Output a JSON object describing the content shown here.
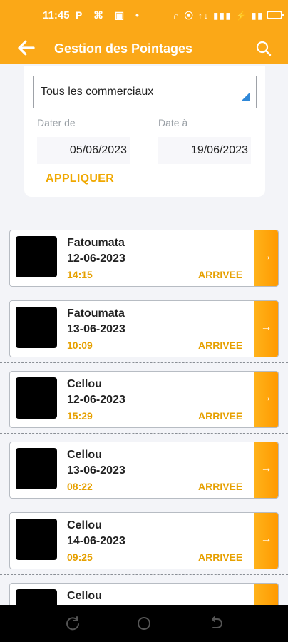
{
  "status_bar": {
    "time": "11:45",
    "left_icons": "P ⌘ ▣ •",
    "right_icons": "∩ ⦿ ↑↓ ▮▮▮ ⚡ ▮▮"
  },
  "app_bar": {
    "title": "Gestion des Pointages",
    "back_icon": "back-arrow-icon",
    "search_icon": "search-icon"
  },
  "filter": {
    "commercial_select": "Tous les commerciaux",
    "date_from_label": "Dater de",
    "date_to_label": "Date à",
    "date_from": "05/06/2023",
    "date_to": "19/06/2023",
    "apply_label": "APPLIQUER"
  },
  "entries": [
    {
      "name": "Fatoumata",
      "date": "12-06-2023",
      "time": "14:15",
      "status": "ARRIVEE",
      "arrow": "→"
    },
    {
      "name": "Fatoumata",
      "date": "13-06-2023",
      "time": "10:09",
      "status": "ARRIVEE",
      "arrow": "→"
    },
    {
      "name": "Cellou",
      "date": "12-06-2023",
      "time": "15:29",
      "status": "ARRIVEE",
      "arrow": "→"
    },
    {
      "name": "Cellou",
      "date": "13-06-2023",
      "time": "08:22",
      "status": "ARRIVEE",
      "arrow": "→"
    },
    {
      "name": "Cellou",
      "date": "14-06-2023",
      "time": "09:25",
      "status": "ARRIVEE",
      "arrow": "→"
    },
    {
      "name": "Cellou",
      "date": "",
      "time": "",
      "status": "",
      "arrow": "→"
    }
  ],
  "colors": {
    "primary": "#fba817",
    "accent_text": "#e6a000",
    "select_arrow": "#2f88d8"
  }
}
